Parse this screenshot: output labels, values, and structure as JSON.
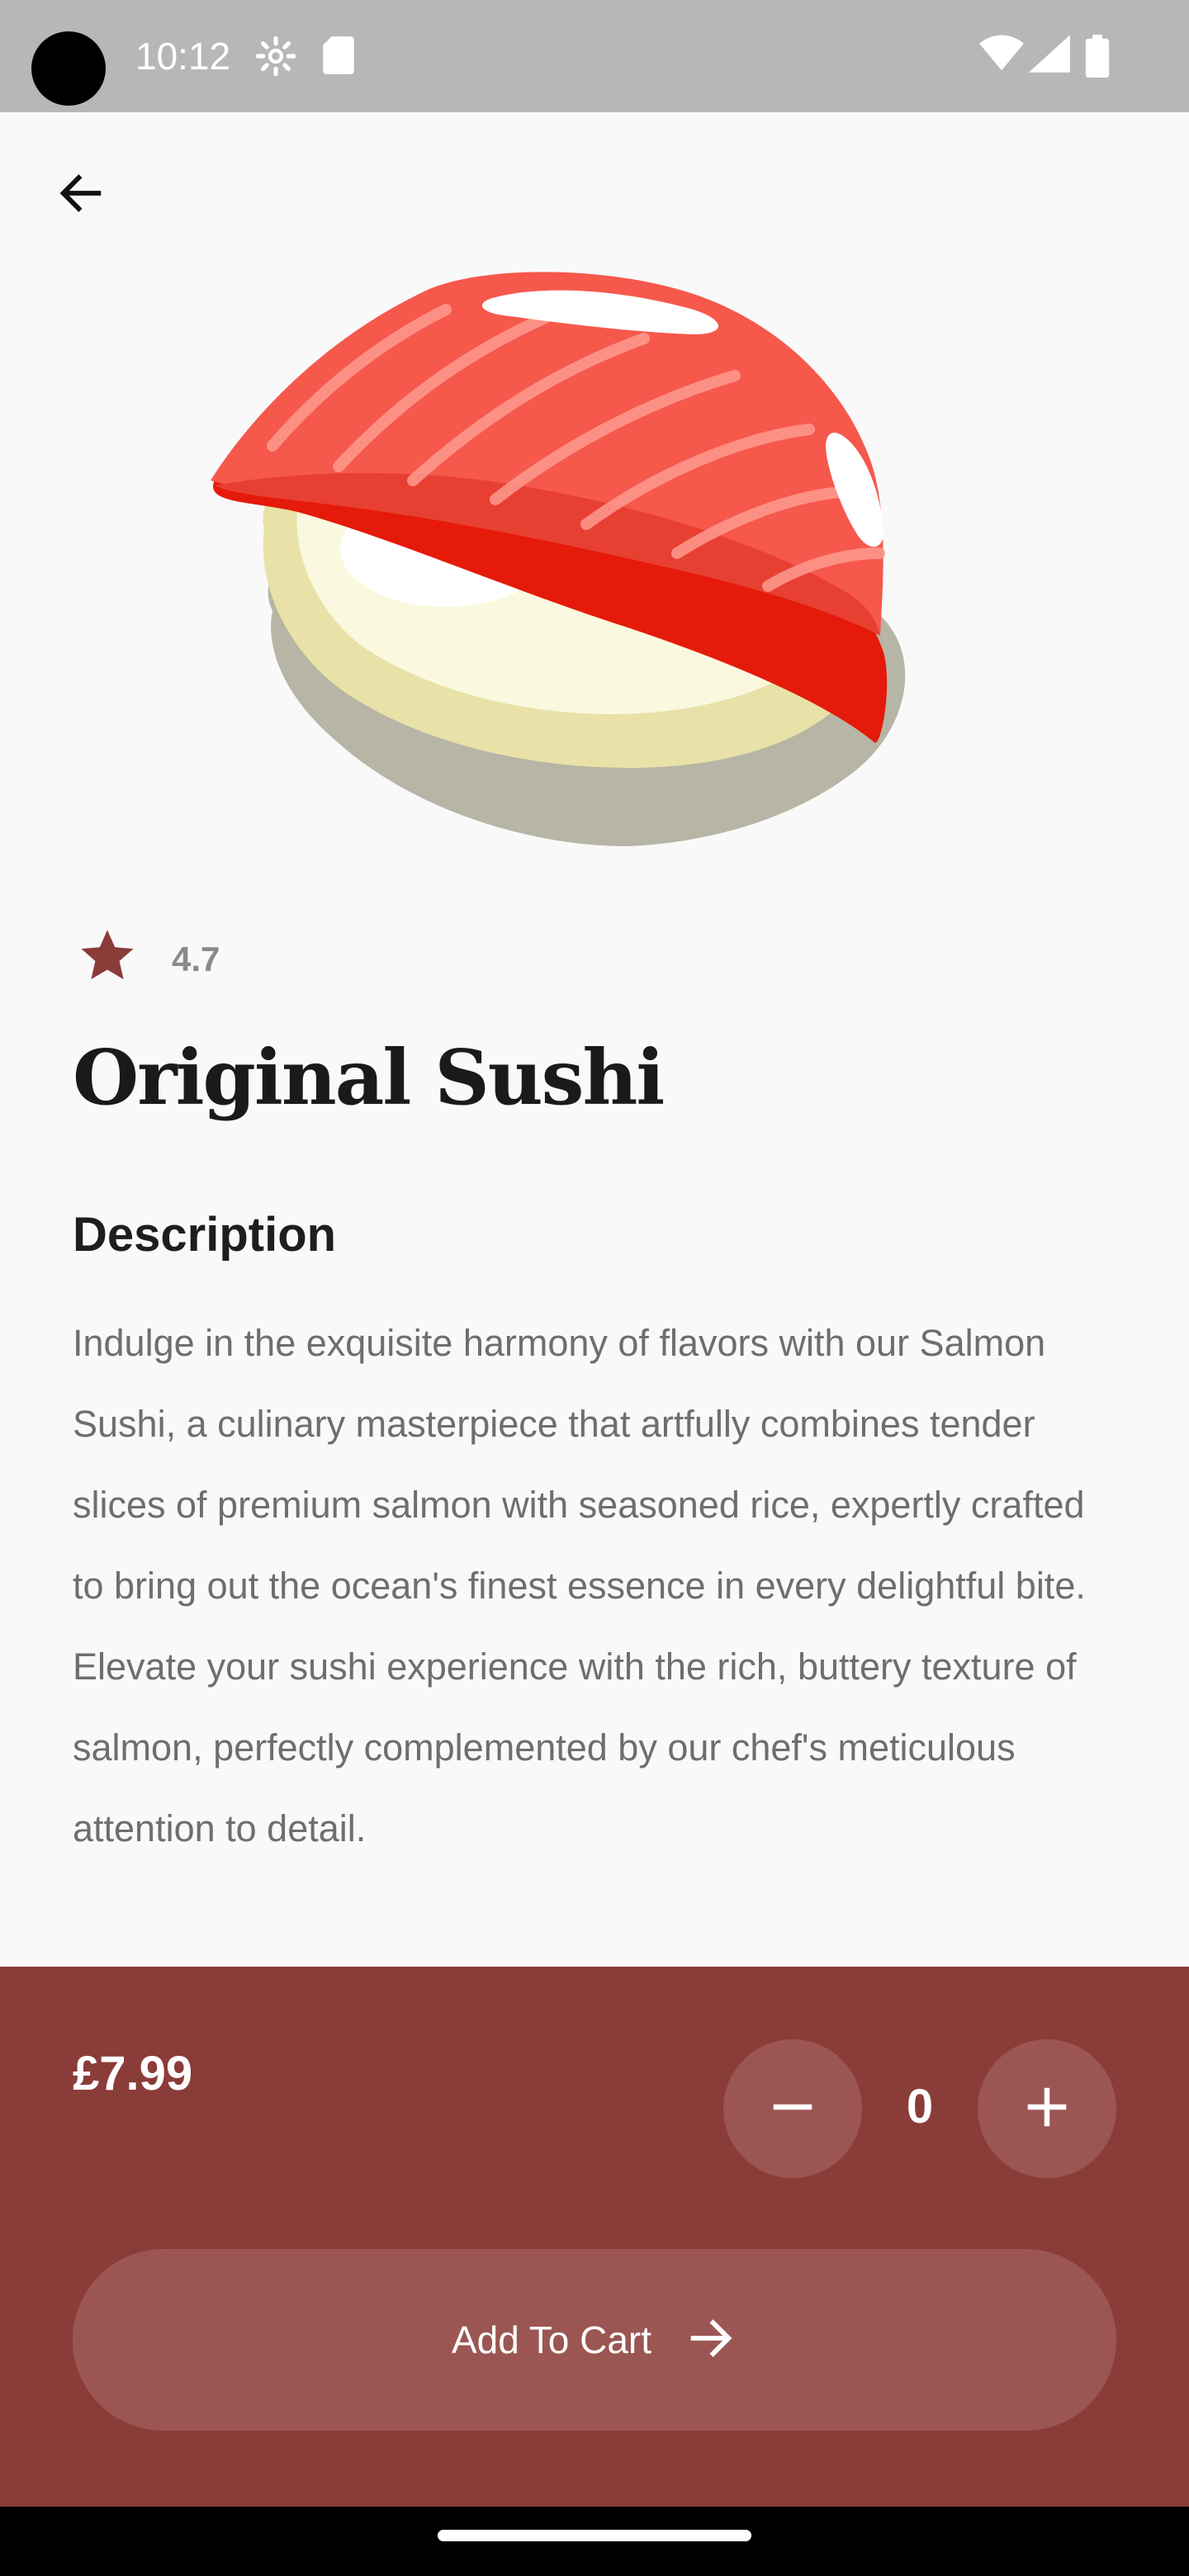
{
  "status_bar": {
    "time": "10:12",
    "icons": [
      "camera-cutout",
      "gear-icon",
      "sd-card-icon",
      "wifi-icon",
      "signal-icon",
      "battery-icon"
    ]
  },
  "app_bar": {
    "back_icon": "arrow-left-icon"
  },
  "product": {
    "image": "salmon-sushi-illustration",
    "rating": "4.7",
    "rating_icon": "star-icon",
    "name": "Original Sushi",
    "description_heading": "Description",
    "description": "Indulge in the exquisite harmony of flavors with our Salmon Sushi, a culinary masterpiece that artfully combines tender slices of premium salmon with seasoned rice, expertly crafted to bring out the ocean's finest essence in every delightful bite. Elevate your sushi experience with the rich, buttery texture of salmon, perfectly complemented by our chef's meticulous attention to detail."
  },
  "checkout": {
    "price": "£7.99",
    "quantity": "0",
    "decrement_icon": "minus-icon",
    "increment_icon": "plus-icon",
    "add_to_cart_label": "Add To Cart",
    "add_to_cart_icon": "arrow-right-icon"
  },
  "colors": {
    "panel": "#8a3c39",
    "panel_button": "#9b5653",
    "star": "#8a3c39",
    "background": "#f9f9f9"
  }
}
